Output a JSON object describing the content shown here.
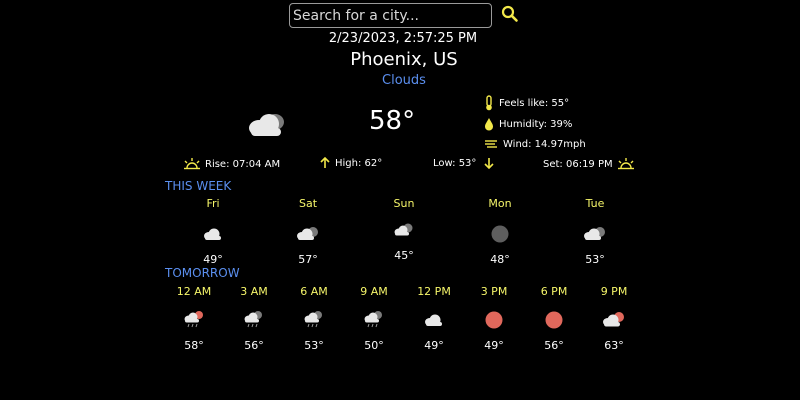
{
  "search": {
    "placeholder": "Search for a city..."
  },
  "datetime": "2/23/2023, 2:57:25 PM",
  "city": "Phoenix, US",
  "condition": "Clouds",
  "temperature": "58°",
  "details": {
    "feels_like": "Feels like: 55°",
    "humidity": "Humidity: 39%",
    "wind": "Wind: 14.97mph"
  },
  "sun_info": {
    "rise": "Rise: 07:04 AM",
    "high": "High: 62°",
    "low": "Low: 53°",
    "set": "Set: 06:19 PM"
  },
  "this_week": {
    "title": "THIS WEEK",
    "days": [
      {
        "label": "Fri",
        "icon": "cloud-icon",
        "temp": "49°"
      },
      {
        "label": "Sat",
        "icon": "cloud-dark-icon",
        "temp": "57°"
      },
      {
        "label": "Sun",
        "icon": "cloud-dark-icon",
        "temp": "45°"
      },
      {
        "label": "Mon",
        "icon": "overcast-dot-icon",
        "temp": "48°"
      },
      {
        "label": "Tue",
        "icon": "cloud-dark-icon",
        "temp": "53°"
      }
    ]
  },
  "tomorrow": {
    "title": "TOMORROW",
    "hours": [
      {
        "label": "12 AM",
        "icon": "cloud-rain-moon-icon",
        "temp": "58°"
      },
      {
        "label": "3 AM",
        "icon": "cloud-rain-icon",
        "temp": "56°"
      },
      {
        "label": "6 AM",
        "icon": "cloud-rain-icon",
        "temp": "53°"
      },
      {
        "label": "9 AM",
        "icon": "cloud-rain-icon",
        "temp": "50°"
      },
      {
        "label": "12 PM",
        "icon": "cloud-icon",
        "temp": "49°"
      },
      {
        "label": "3 PM",
        "icon": "sun-icon",
        "temp": "49°"
      },
      {
        "label": "6 PM",
        "icon": "sun-icon",
        "temp": "56°"
      },
      {
        "label": "9 PM",
        "icon": "cloud-sun-icon",
        "temp": "63°"
      }
    ]
  },
  "colors": {
    "accent_blue": "#5b8fef",
    "label_yellow": "#f6f66a",
    "icon_yellow": "#f2e84a",
    "sun_red": "#e0685c"
  }
}
